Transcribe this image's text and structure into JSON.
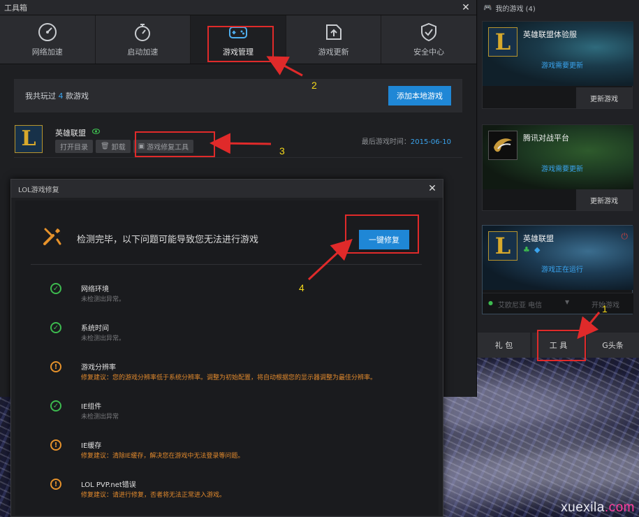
{
  "toolbox": {
    "title": "工具箱",
    "close": "✕",
    "tabs": [
      {
        "label": "网络加速",
        "icon": "gauge-icon"
      },
      {
        "label": "启动加速",
        "icon": "stopwatch-icon"
      },
      {
        "label": "游戏管理",
        "icon": "gamepad-icon"
      },
      {
        "label": "游戏更新",
        "icon": "upload-icon"
      },
      {
        "label": "安全中心",
        "icon": "shield-icon"
      }
    ],
    "summary": {
      "prefix": "我共玩过",
      "count": "4",
      "suffix": "款游戏",
      "add_button": "添加本地游戏"
    },
    "game": {
      "name": "英雄联盟",
      "logo": "L",
      "buttons": [
        "打开目录",
        "卸载",
        "游戏修复工具"
      ],
      "last_played_label": "最后游戏时间：",
      "last_played_date": "2015-06-10"
    }
  },
  "right_panel": {
    "header": "我的游戏 (4)",
    "cards": [
      {
        "title": "英雄联盟体验服",
        "logo": "L",
        "status": "游戏需要更新",
        "button": "更新游戏"
      },
      {
        "title": "腾讯对战平台",
        "logo": "",
        "status": "游戏需要更新",
        "button": "更新游戏"
      },
      {
        "title": "英雄联盟",
        "logo": "L",
        "status": "游戏正在运行",
        "server": "艾欧尼亚 电信",
        "start": "开始游戏"
      }
    ],
    "bottom_buttons": [
      "礼 包",
      "工 具",
      "G头条"
    ]
  },
  "dialog": {
    "title": "LOL游戏修复",
    "close": "✕",
    "message": "检测完毕，以下问题可能导致您无法进行游戏",
    "fix_button": "一键修复",
    "checks": [
      {
        "status": "ok",
        "name": "网络环境",
        "detail": "未检测出异常。"
      },
      {
        "status": "ok",
        "name": "系统时间",
        "detail": "未检测出异常。"
      },
      {
        "status": "warn",
        "name": "游戏分辨率",
        "detail": "修复建议：您的游戏分辨率低于系统分辨率。调整为初始配置，将自动根据您的显示器调整为最佳分辨率。"
      },
      {
        "status": "ok",
        "name": "IE组件",
        "detail": "未检测出异常"
      },
      {
        "status": "warn",
        "name": "IE缓存",
        "detail": "修复建议：清除IE缓存，解决您在游戏中无法登录等问题。"
      },
      {
        "status": "warn",
        "name": "LOL PVP.net错误",
        "detail": "修复建议：请进行修复，否者将无法正常进入游戏。"
      }
    ]
  },
  "annotations": {
    "step1": "1",
    "step2": "2",
    "step3": "3",
    "step4": "4"
  },
  "watermark": {
    "part1": "xuexila",
    "part2": ".com"
  },
  "colors": {
    "accent_blue": "#1f87d6",
    "highlight_red": "#e02a2a",
    "ok_green": "#3dbb4f",
    "warn_orange": "#e6922b",
    "step_yellow": "#f5d91a"
  }
}
